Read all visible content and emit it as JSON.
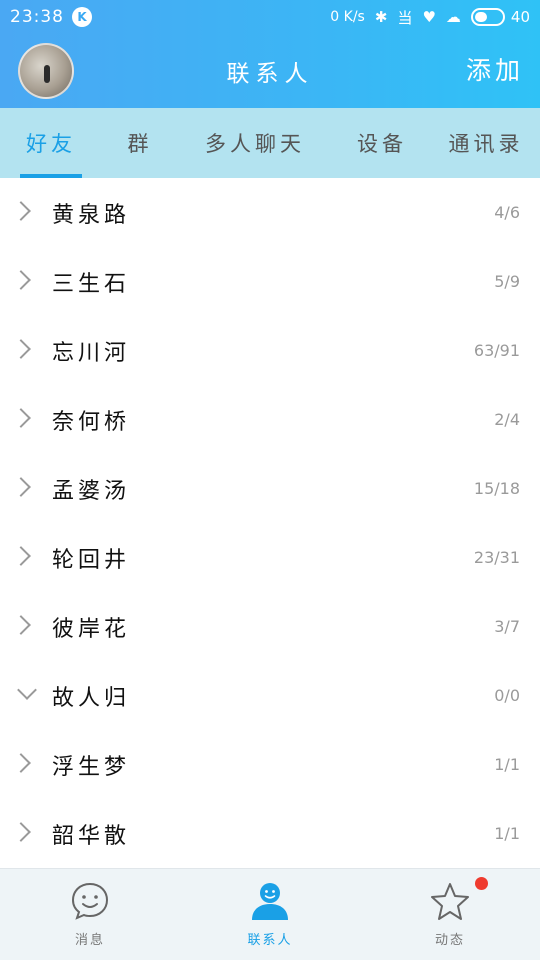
{
  "status": {
    "time": "23:38",
    "k_badge": "K",
    "net_speed": "0 K/s",
    "bluetooth": "✱",
    "signal1": "当",
    "heart": "♥",
    "icons2": "☁",
    "battery_level": "40"
  },
  "header": {
    "title": "联系人",
    "add_label": "添加"
  },
  "tabs": [
    {
      "label": "好友",
      "active": true
    },
    {
      "label": "群"
    },
    {
      "label": "多人聊天"
    },
    {
      "label": "设备"
    },
    {
      "label": "通讯录"
    }
  ],
  "groups": [
    {
      "name": "黄泉路",
      "count": "4/6",
      "expanded": false
    },
    {
      "name": "三生石",
      "count": "5/9",
      "expanded": false
    },
    {
      "name": "忘川河",
      "count": "63/91",
      "expanded": false
    },
    {
      "name": "奈何桥",
      "count": "2/4",
      "expanded": false
    },
    {
      "name": "孟婆汤",
      "count": "15/18",
      "expanded": false
    },
    {
      "name": "轮回井",
      "count": "23/31",
      "expanded": false
    },
    {
      "name": "彼岸花",
      "count": "3/7",
      "expanded": false
    },
    {
      "name": "故人归",
      "count": "0/0",
      "expanded": true
    },
    {
      "name": "浮生梦",
      "count": "1/1",
      "expanded": false
    },
    {
      "name": "韶华散",
      "count": "1/1",
      "expanded": false
    }
  ],
  "bottom_nav": [
    {
      "label": "消息",
      "icon": "smiley-bubble-icon"
    },
    {
      "label": "联系人",
      "icon": "person-icon",
      "active": true
    },
    {
      "label": "动态",
      "icon": "star-icon",
      "badge": "red-dot"
    }
  ],
  "colors": {
    "accent": "#1aa0e6",
    "header_start": "#4aa8f3",
    "header_end": "#2fc2f6",
    "tabbar_bg": "#b3e3f0",
    "badge_red": "#ef3b2f"
  }
}
